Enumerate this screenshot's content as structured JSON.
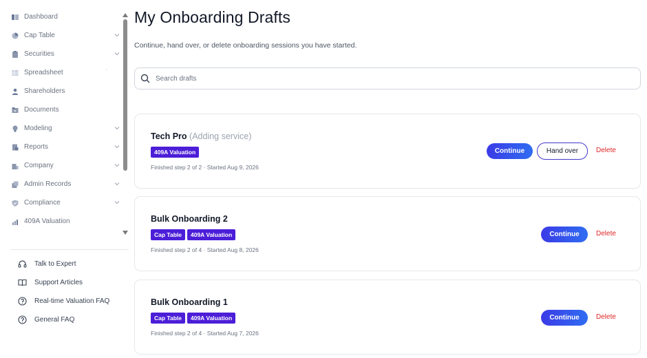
{
  "sidebar": {
    "items": [
      {
        "label": "Dashboard",
        "icon": "dashboard-icon",
        "has_chevron": false
      },
      {
        "label": "Cap Table",
        "icon": "pie-chart-icon",
        "has_chevron": true
      },
      {
        "label": "Securities",
        "icon": "clipboard-icon",
        "has_chevron": true
      },
      {
        "label": "Spreadsheet",
        "icon": "spreadsheet-icon",
        "has_chevron": false
      },
      {
        "label": "Shareholders",
        "icon": "user-icon",
        "has_chevron": false
      },
      {
        "label": "Documents",
        "icon": "folder-icon",
        "has_chevron": false
      },
      {
        "label": "Modeling",
        "icon": "lightbulb-icon",
        "has_chevron": true
      },
      {
        "label": "Reports",
        "icon": "report-icon",
        "has_chevron": true
      },
      {
        "label": "Company",
        "icon": "building-icon",
        "has_chevron": true
      },
      {
        "label": "Admin Records",
        "icon": "records-icon",
        "has_chevron": true
      },
      {
        "label": "Compliance",
        "icon": "shield-icon",
        "has_chevron": true
      },
      {
        "label": "409A Valuation",
        "icon": "chart-icon",
        "has_chevron": false
      }
    ],
    "help": [
      {
        "label": "Talk to Expert",
        "icon": "headset-icon"
      },
      {
        "label": "Support Articles",
        "icon": "book-icon"
      },
      {
        "label": "Real-time Valuation FAQ",
        "icon": "question-circle-icon"
      },
      {
        "label": "General FAQ",
        "icon": "question-circle-icon"
      }
    ]
  },
  "page": {
    "title": "My Onboarding Drafts",
    "subtitle": "Continue, hand over, or delete onboarding sessions you have started.",
    "search_placeholder": "Search drafts"
  },
  "drafts": [
    {
      "name": "Tech Pro",
      "extra": "(Adding service)",
      "tags": [
        "409A Valuation"
      ],
      "meta": "Finished step 2 of 2 · Started Aug 9, 2026",
      "continue_label": "Continue",
      "handover_label": "Hand over",
      "delete_label": "Delete"
    },
    {
      "name": "Bulk Onboarding 2",
      "extra": "",
      "tags": [
        "Cap Table",
        "409A Valuation"
      ],
      "meta": "Finished step 2 of 4 · Started Aug 8, 2026",
      "continue_label": "Continue",
      "delete_label": "Delete"
    },
    {
      "name": "Bulk Onboarding 1",
      "extra": "",
      "tags": [
        "Cap Table",
        "409A Valuation"
      ],
      "meta": "Finished step 2 of 4 · Started Aug 7, 2026",
      "continue_label": "Continue",
      "delete_label": "Delete"
    }
  ],
  "colors": {
    "accent": "#4c1ed8",
    "continue_start": "#3b3be6",
    "continue_end": "#2f6df2",
    "delete": "#dc2626",
    "nav_icon": "#6b7a99"
  }
}
